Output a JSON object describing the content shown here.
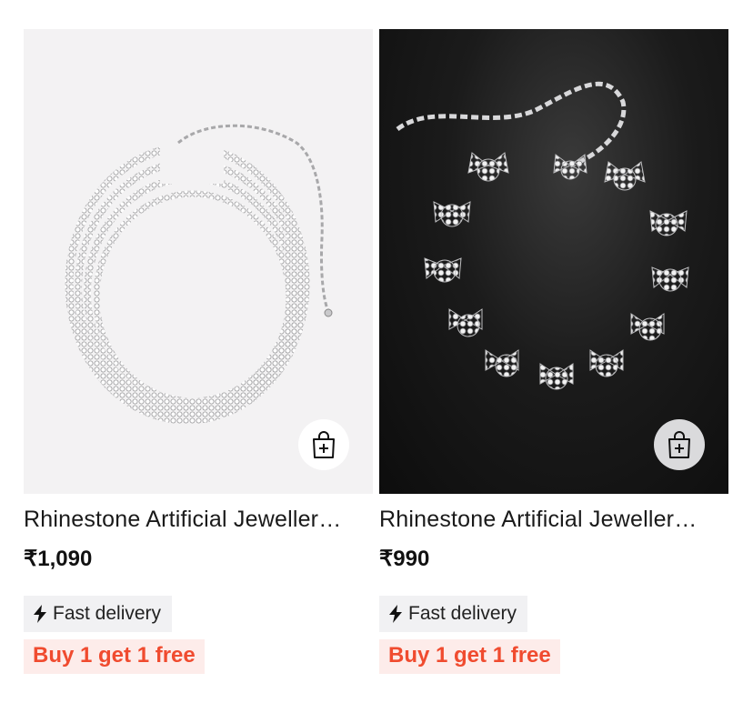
{
  "products": [
    {
      "title": "Rhinestone Artificial Jewellery Necklace",
      "price": "₹1,090",
      "delivery_label": "Fast delivery",
      "offer_label": "Buy 1 get 1 free",
      "image_bg": "#f3f2f3",
      "add_to_bag_icon": "shopping-bag-plus-icon",
      "delivery_icon": "lightning-bolt-icon"
    },
    {
      "title": "Rhinestone Artificial Jewellery Choker",
      "price": "₹990",
      "delivery_label": "Fast delivery",
      "offer_label": "Buy 1 get 1 free",
      "image_bg": "#111111",
      "add_to_bag_icon": "shopping-bag-plus-icon",
      "delivery_icon": "lightning-bolt-icon"
    }
  ],
  "colors": {
    "offer_text": "#f04b2f",
    "offer_bg": "#fdecea",
    "chip_bg": "#f1f1f3"
  }
}
